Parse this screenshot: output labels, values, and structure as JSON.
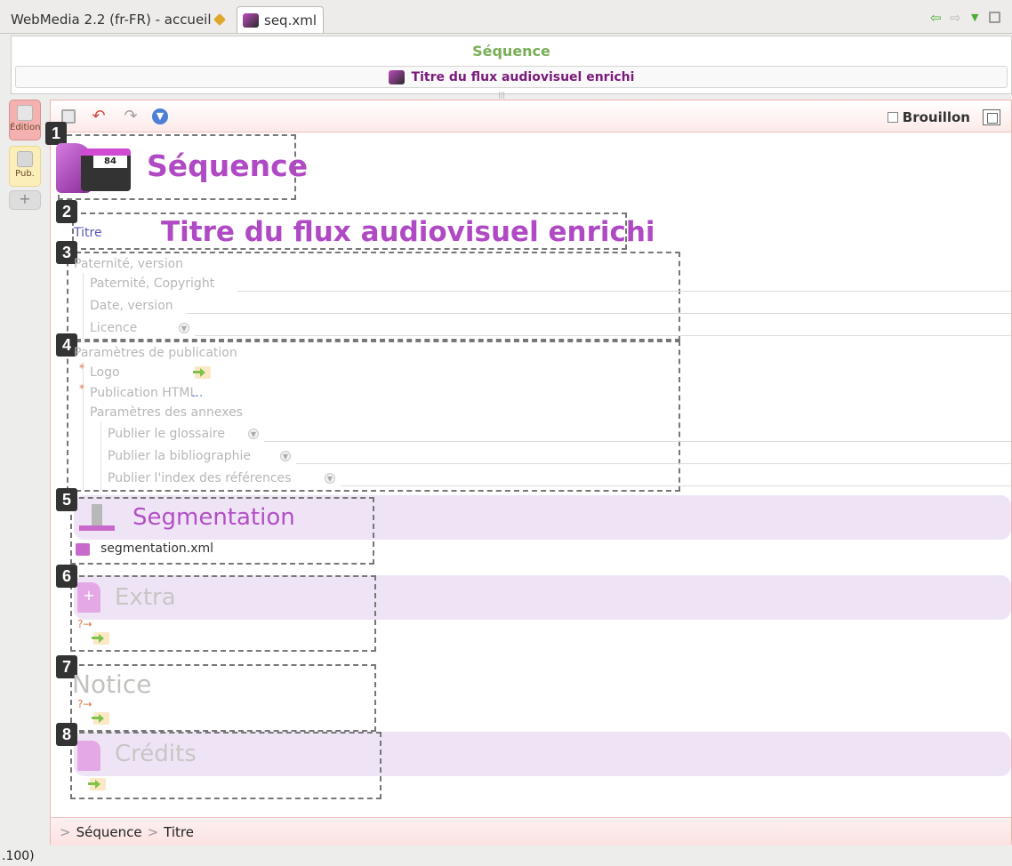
{
  "tabs": {
    "home_label": "WebMedia 2.2 (fr-FR) - accueil",
    "file_label": "seq.xml"
  },
  "header": {
    "type_title": "Séquence",
    "doc_title": "Titre du flux audiovisuel enrichi"
  },
  "side_tabs": {
    "edit_label": "Édition",
    "pub_label": "Pub.",
    "add_label": "+"
  },
  "toolbar": {
    "draft_label": "Brouillon"
  },
  "badges": [
    "1",
    "2",
    "3",
    "4",
    "5",
    "6",
    "7",
    "8"
  ],
  "doc": {
    "type_heading": "Séquence",
    "title_label": "Titre",
    "title_value": "Titre du flux audiovisuel enrichi",
    "authorship": {
      "group_label": "Paternité, version",
      "copyright_label": "Paternité, Copyright",
      "date_label": "Date, version",
      "license_label": "Licence"
    },
    "publication": {
      "group_label": "Paramètres de publication",
      "logo_label": "Logo",
      "html_label": "Publication HTML",
      "html_more": "...",
      "annexes_label": "Paramètres des annexes",
      "glossary_label": "Publier le glossaire",
      "biblio_label": "Publier la bibliographie",
      "refs_label": "Publier l'index des références"
    },
    "segmentation": {
      "title": "Segmentation",
      "file": "segmentation.xml"
    },
    "extra": {
      "title": "Extra",
      "qarrow": "?→"
    },
    "notice": {
      "title": "Notice",
      "qarrow": "?→"
    },
    "credits": {
      "title": "Crédits"
    }
  },
  "breadcrumb": {
    "sep": ">",
    "items": [
      "Séquence",
      "Titre"
    ]
  },
  "status": {
    "text": ".100)"
  },
  "colors": {
    "accent_purple": "#b04ac4",
    "accent_green": "#7aae56",
    "edit_tab": "#f5b0b0",
    "pub_tab": "#fbeeb8"
  },
  "icons": [
    "pencil-icon",
    "sequence-icon",
    "back-arrow-icon",
    "forward-arrow-icon",
    "menu-down-icon",
    "restore-icon",
    "save-icon",
    "undo-icon",
    "redo-icon",
    "help-icon",
    "segmentation-icon",
    "document-icon"
  ]
}
